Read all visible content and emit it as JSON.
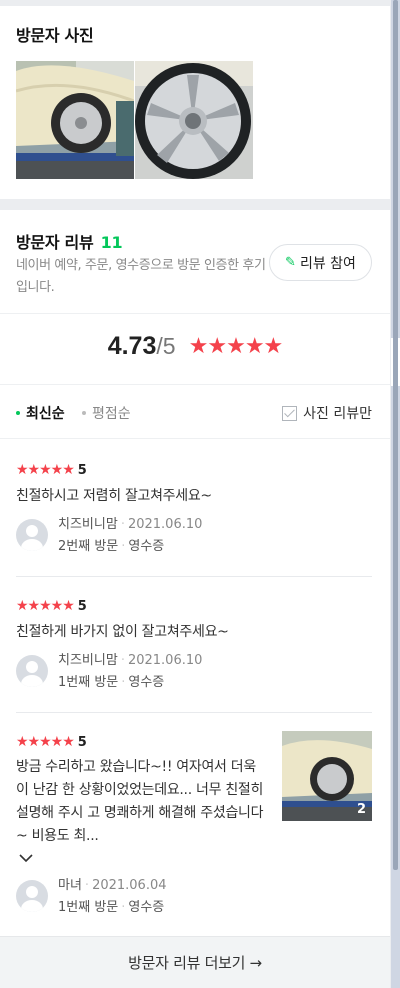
{
  "photos": {
    "title": "방문자 사진",
    "items": [
      "wheel-photo",
      "wheel-closeup-photo"
    ]
  },
  "reviews": {
    "title": "방문자 리뷰",
    "count": "11",
    "subtitle": "네이버 예약, 주문, 영수증으로 방문 인증한 후기입니다.",
    "write_button": "리뷰 참여",
    "average": "4.73",
    "max": "/5",
    "stars": "★★★★★",
    "sort_latest": "최신순",
    "sort_rating": "평점순",
    "photo_only": "사진 리뷰만",
    "more_button": "방문자 리뷰 더보기 →",
    "items": [
      {
        "stars": "★★★★★",
        "score": "5",
        "text": "친절하시고 저렴히 잘고쳐주세요~",
        "author": "치즈비니맘",
        "date": "2021.06.10",
        "visit": "2번째 방문",
        "receipt": "영수증"
      },
      {
        "stars": "★★★★★",
        "score": "5",
        "text": "친절하게 바가지 없이 잘고쳐주세요~",
        "author": "치즈비니맘",
        "date": "2021.06.10",
        "visit": "1번째 방문",
        "receipt": "영수증"
      },
      {
        "stars": "★★★★★",
        "score": "5",
        "text": "방금 수리하고 왔습니다~!! 여자여서 더욱이 난감 한 상황이었었는데요... 너무 친절히 설명해 주시 고 명쾌하게 해결해 주셨습니다~ 비용도 최...",
        "author": "마녀",
        "date": "2021.06.04",
        "visit": "1번째 방문",
        "receipt": "영수증",
        "photo_count": "2"
      }
    ]
  },
  "colors": {
    "accent": "#03c75a",
    "star": "#f4424b"
  }
}
